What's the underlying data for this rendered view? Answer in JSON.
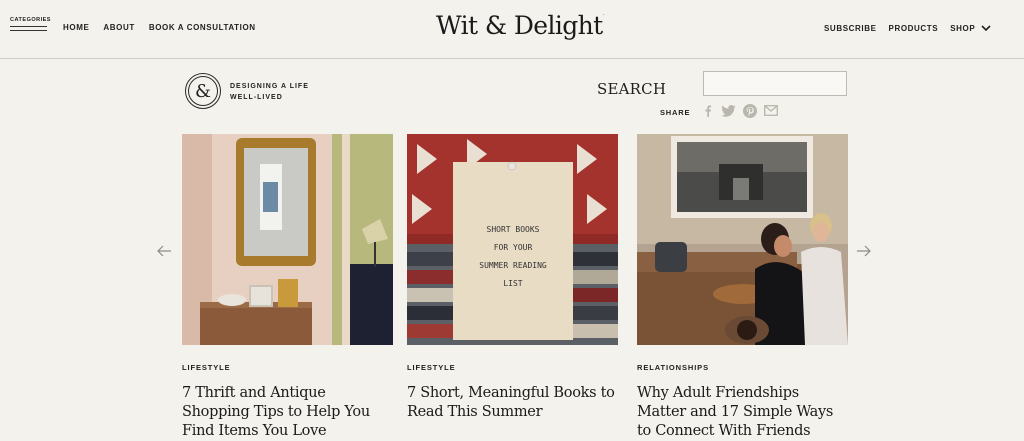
{
  "header": {
    "categories_label": "CATEGORIES",
    "nav_left": [
      "HOME",
      "ABOUT",
      "BOOK A CONSULTATION"
    ],
    "brand": "Wit & Delight",
    "brand_mark": ".",
    "nav_right": [
      "SUBSCRIBE",
      "PRODUCTS",
      "SHOP"
    ]
  },
  "tagline": {
    "logo_glyph": "&",
    "text_line1": "DESIGNING A LIFE",
    "text_line2": "WELL-LIVED"
  },
  "search": {
    "label": "SEARCH",
    "value": "",
    "placeholder": ""
  },
  "share": {
    "label": "SHARE",
    "icons": [
      "facebook-icon",
      "twitter-icon",
      "pinterest-icon",
      "email-icon"
    ]
  },
  "cards": [
    {
      "category": "LIFESTYLE",
      "title": "7 Thrift and Antique Shopping Tips to Help You Find Items You Love"
    },
    {
      "category": "LIFESTYLE",
      "title": "7 Short, Meaningful Books to Read This Summer",
      "image_text": [
        "SHORT BOOKS",
        "FOR YOUR",
        "SUMMER READING",
        "LIST"
      ]
    },
    {
      "category": "RELATIONSHIPS",
      "title": "Why Adult Friendships Matter and 17 Simple Ways to Connect With Friends"
    }
  ],
  "colors": {
    "background": "#f4f2ec",
    "text": "#1f1f1f",
    "border": "#cfcdc6"
  }
}
